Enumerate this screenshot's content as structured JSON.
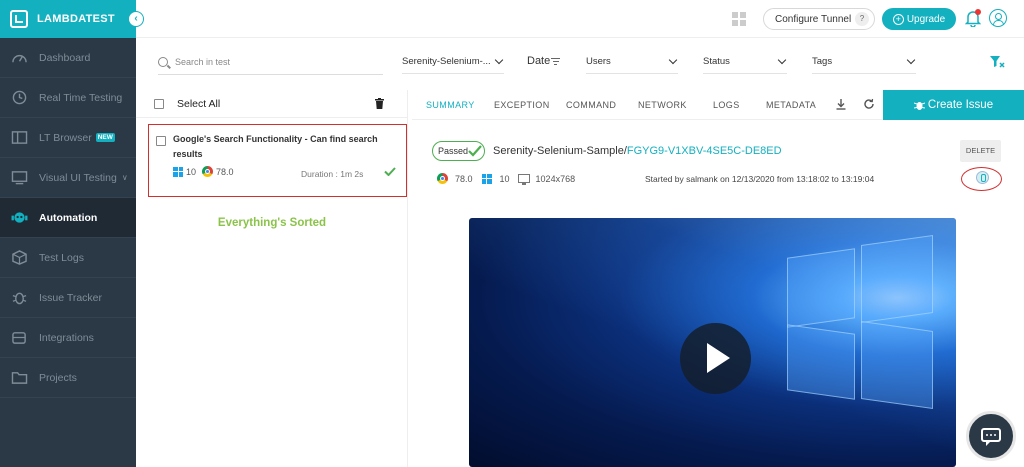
{
  "brand": {
    "name": "LAMBDATEST"
  },
  "sidebar": {
    "items": [
      {
        "label": "Dashboard",
        "icon": "speedometer-icon",
        "active": false
      },
      {
        "label": "Real Time Testing",
        "icon": "clock-icon",
        "active": false
      },
      {
        "label": "LT Browser",
        "icon": "browser-icon",
        "badge": "NEW",
        "active": false
      },
      {
        "label": "Visual UI Testing",
        "icon": "monitor-icon",
        "active": false
      },
      {
        "label": "Automation",
        "icon": "robot-icon",
        "active": true
      },
      {
        "label": "Test Logs",
        "icon": "cube-icon",
        "active": false
      },
      {
        "label": "Issue Tracker",
        "icon": "bug-icon",
        "active": false
      },
      {
        "label": "Integrations",
        "icon": "puzzle-icon",
        "active": false
      },
      {
        "label": "Projects",
        "icon": "folder-icon",
        "active": false
      }
    ]
  },
  "topbar": {
    "configure_tunnel": "Configure Tunnel",
    "tunnel_help": "?",
    "upgrade": "Upgrade"
  },
  "filters": {
    "search_placeholder": "Search in test",
    "build": "Serenity-Selenium-...",
    "date": "Date",
    "users": "Users",
    "status": "Status",
    "tags": "Tags"
  },
  "list": {
    "select_all": "Select All",
    "test": {
      "title": "Google's Search Functionality - Can find search results",
      "os_version": "10",
      "browser_version": "78.0",
      "duration": "Duration : 1m 2s"
    },
    "sorted_message": "Everything's Sorted"
  },
  "detail": {
    "tabs": [
      "SUMMARY",
      "EXCEPTION",
      "COMMAND",
      "NETWORK",
      "LOGS",
      "METADATA"
    ],
    "create_issue": "Create Issue",
    "status": "Passed",
    "build_name": "Serenity-Selenium-Sample/",
    "session_id": "FGYG9-V1XBV-4SE5C-DE8ED",
    "delete": "DELETE",
    "browser_version": "78.0",
    "os_version": "10",
    "resolution": "1024x768",
    "started_text": "Started by salmank on 12/13/2020 from 13:18:02 to 13:19:04"
  },
  "colors": {
    "accent": "#13b0c0",
    "sidebar_bg": "#2b3947",
    "passed": "#4caf50",
    "highlight": "#d32f2f",
    "sorted": "#8bc34a"
  }
}
